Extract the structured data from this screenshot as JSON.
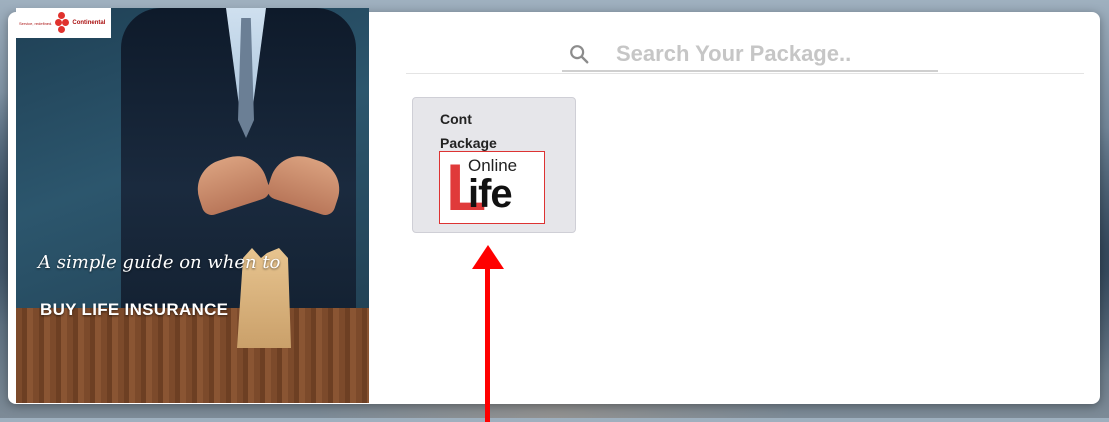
{
  "promo": {
    "logo_tagline": "Service, redefined.",
    "logo_name": "Continental",
    "headline": "A simple guide on when to",
    "subheadline": "BUY LIFE INSURANCE"
  },
  "search": {
    "placeholder": "Search Your Package..",
    "icon": "search-icon"
  },
  "packages": [
    {
      "title_line1": "Cont",
      "title_line2": "Package",
      "logo": {
        "big_letter": "L",
        "top_word": "Online",
        "rest": "ife"
      }
    }
  ],
  "colors": {
    "accent_red": "#ff0000",
    "card_bg": "#e6e6ea",
    "logo_red": "#e03a3a"
  }
}
